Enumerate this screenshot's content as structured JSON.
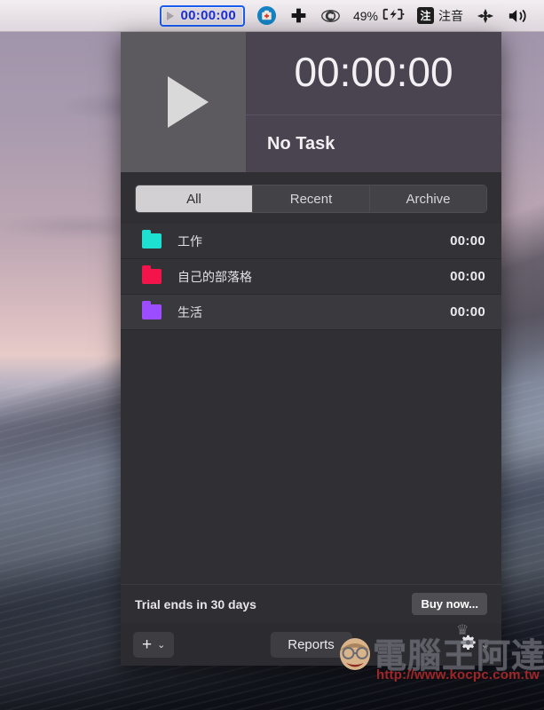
{
  "menubar": {
    "timer_value": "00:00:00",
    "play_icon": "play-triangle-icon",
    "icons": [
      {
        "name": "first-aid-kit-icon",
        "glyph": "first-aid"
      },
      {
        "name": "plus-cross-icon",
        "glyph": "plus-cross"
      },
      {
        "name": "eye-spiral-icon",
        "glyph": "spiral"
      }
    ],
    "battery_percent": "49%",
    "battery_icon": "battery-charging-icon",
    "ime_badge": "注",
    "ime_label": "注音",
    "bluetooth_icon": "scatter-dots-icon",
    "volume_icon": "volume-speaker-icon"
  },
  "app": {
    "header": {
      "play_button_name": "play-button",
      "timer": "00:00:00",
      "task": "No Task"
    },
    "tabs": [
      {
        "label": "All",
        "active": true
      },
      {
        "label": "Recent",
        "active": false
      },
      {
        "label": "Archive",
        "active": false
      }
    ],
    "projects": [
      {
        "name": "工作",
        "time": "00:00",
        "color": "#1ee0d0"
      },
      {
        "name": "自己的部落格",
        "time": "00:00",
        "color": "#f4144c"
      },
      {
        "name": "生活",
        "time": "00:00",
        "color": "#9b4dff"
      }
    ],
    "trial": {
      "text": "Trial ends in 30 days",
      "buy_label": "Buy now..."
    },
    "toolbar": {
      "add_label": "+",
      "add_chevron": "⌄",
      "reports_label": "Reports",
      "gear_icon": "gear-icon",
      "gear_chevron": "⌄"
    }
  },
  "watermark": {
    "site_name": "電腦王阿達",
    "url": "http://www.kocpc.com.tw"
  },
  "colors": {
    "panel_bg": "#303034",
    "header_accent": "#4a4350",
    "play_pane": "#5c5a5e",
    "menubar_highlight": "#1a5cf0",
    "timer_text_blue": "#1b2fd8"
  }
}
